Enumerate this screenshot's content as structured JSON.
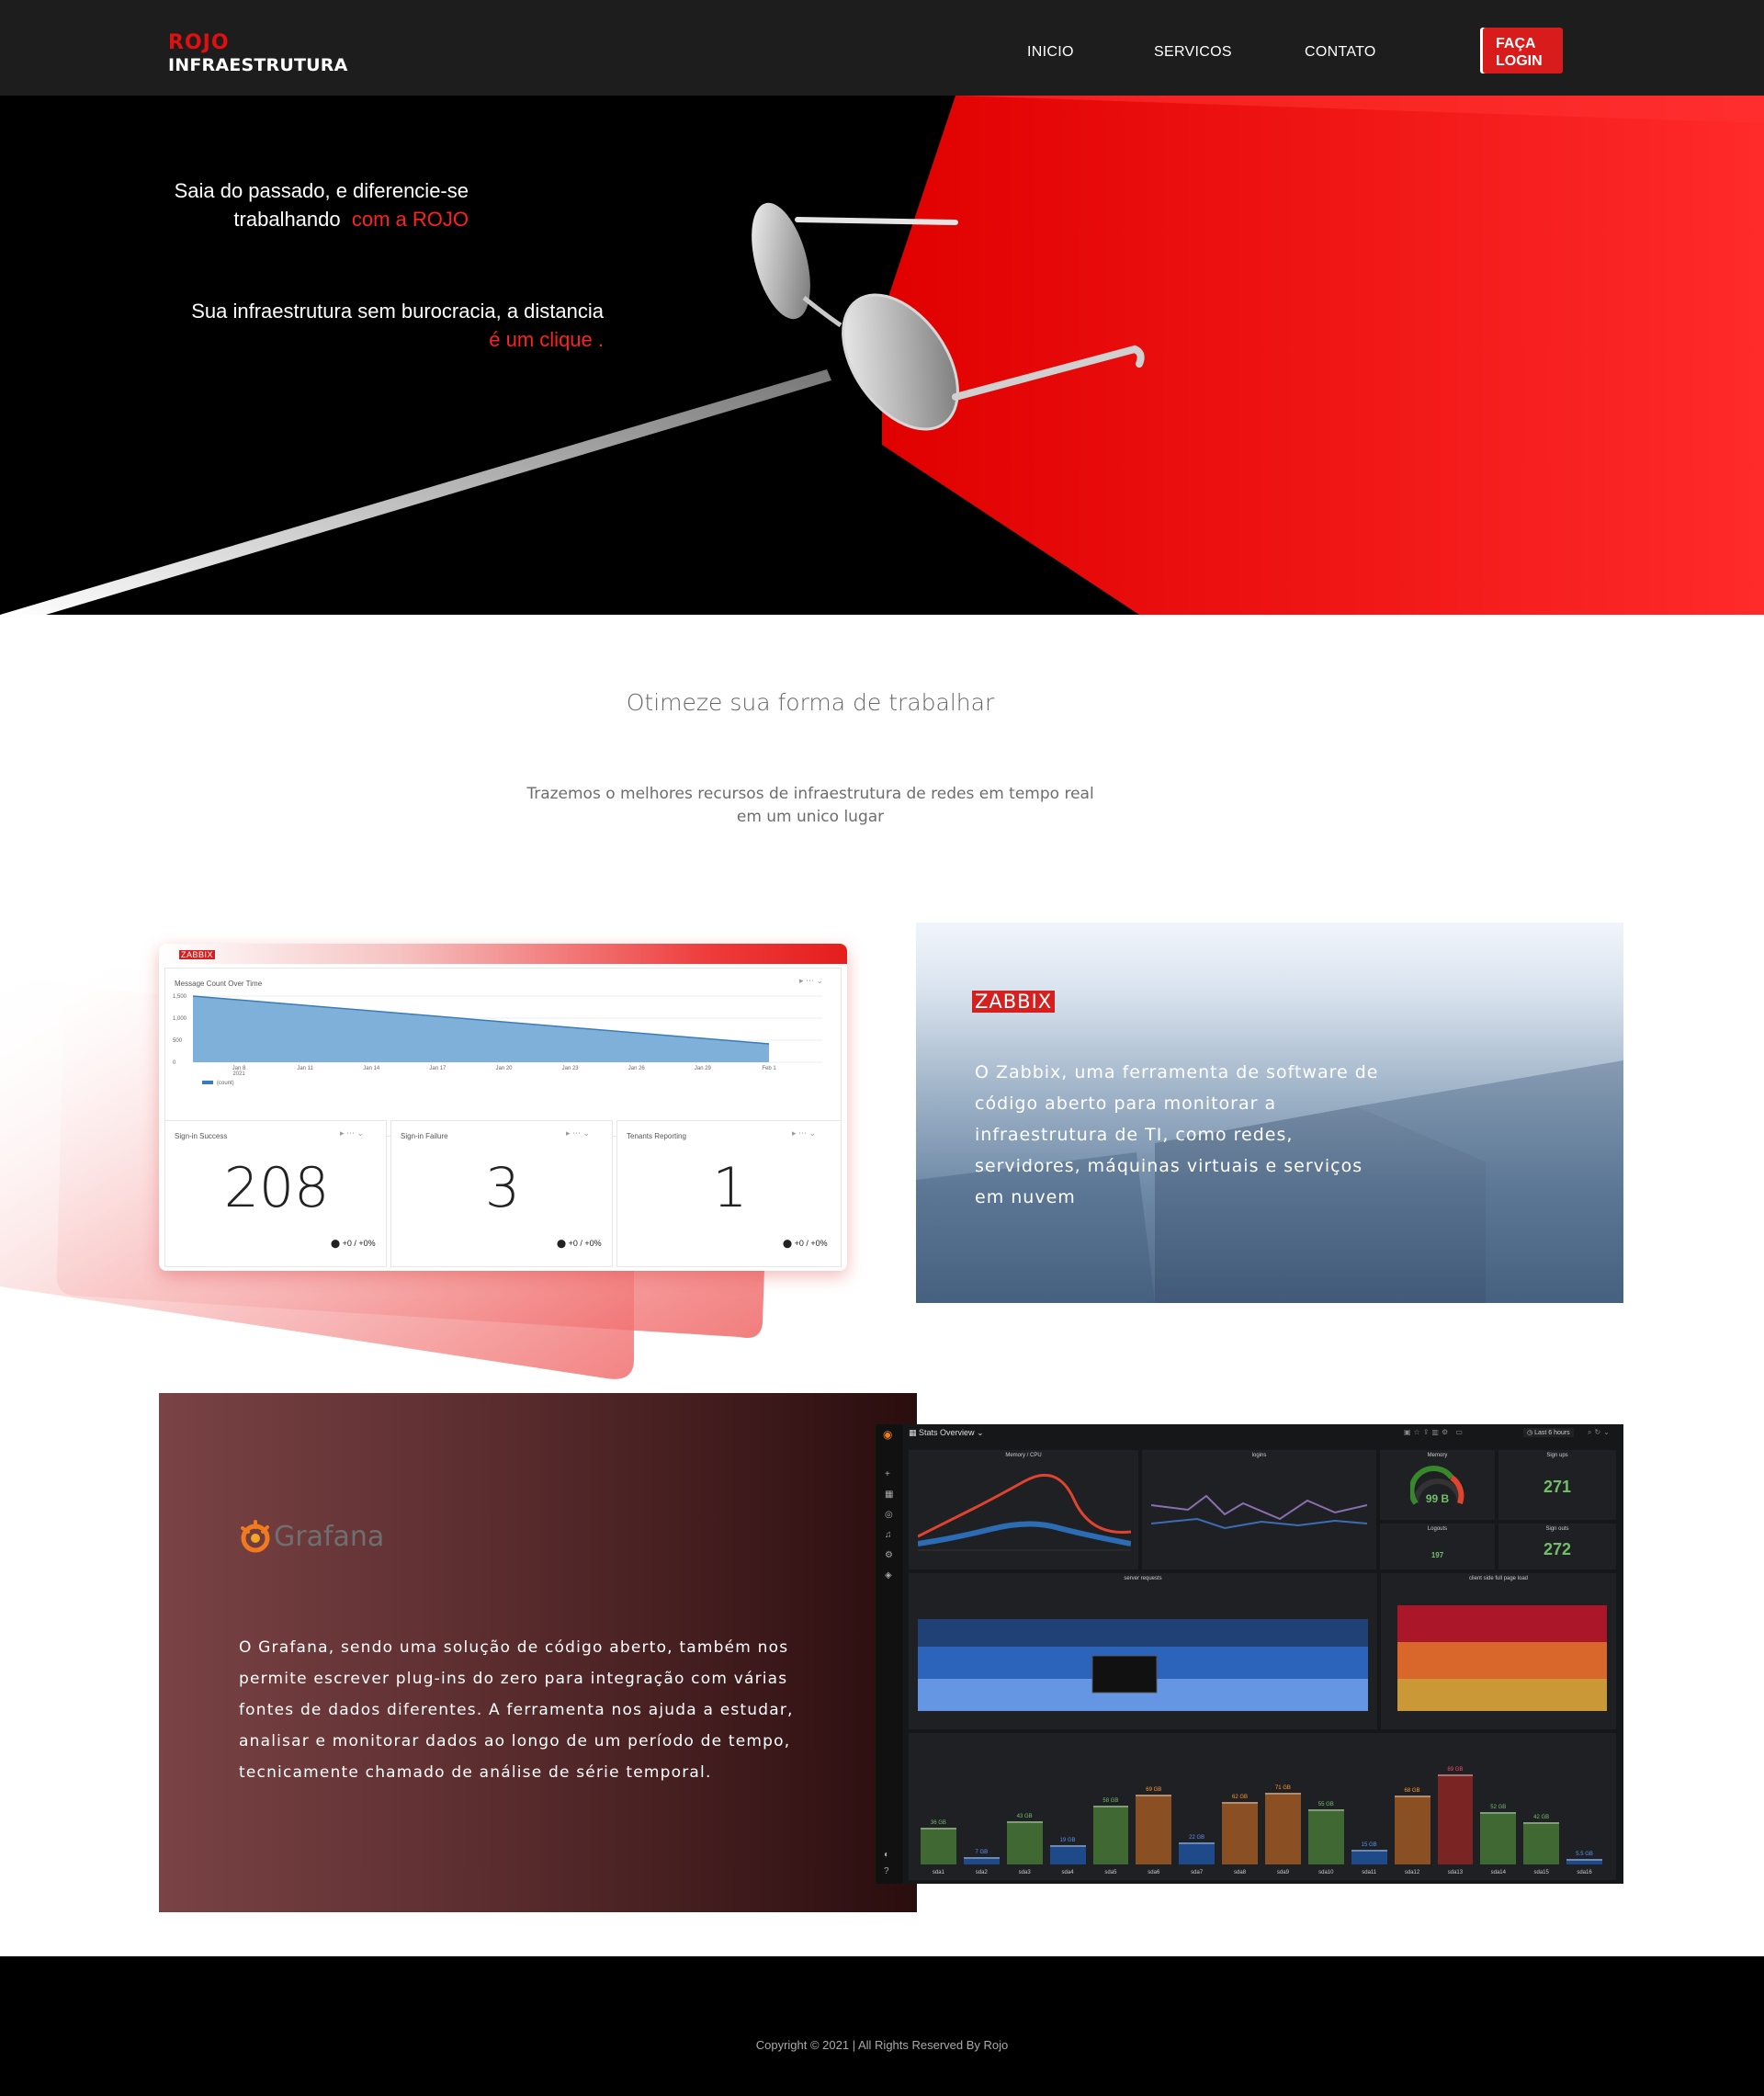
{
  "header": {
    "brand_top": "ROJO",
    "brand_bottom": "INFRAESTRUTURA",
    "nav": [
      "INICIO",
      "SERVICOS",
      "CONTATO"
    ],
    "login_label": "FAÇA\nLOGIN"
  },
  "hero": {
    "line1": "Saia do passado, e diferencie-se",
    "line2_white": "trabalhando",
    "line2_red": "com a ROJO",
    "line3": "Sua infraestrutura sem burocracia, a distancia",
    "line4_red": "é um clique ."
  },
  "intro": {
    "title": "Otimeze sua forma de trabalhar",
    "subtitle_line1": "Trazemos o melhores recursos de infraestrutura de redes em tempo real",
    "subtitle_line2": "em um unico lugar"
  },
  "zabbix": {
    "card_brand": "ZABBIX",
    "chart_title": "Message Count Over Time",
    "chart_yticks": [
      "1,500",
      "1,000",
      "500",
      "0"
    ],
    "chart_xticks": [
      "Jan 8",
      "Jan 11",
      "Jan 14",
      "Jan 17",
      "Jan 20",
      "Jan 23",
      "Jan 26",
      "Jan 29",
      "Feb 1"
    ],
    "chart_year": "2021",
    "chart_legend": "(count)",
    "stats": [
      {
        "title": "Sign-in Success",
        "value": "208",
        "delta": "+0 / +0%"
      },
      {
        "title": "Sign-in Failure",
        "value": "3",
        "delta": "+0 / +0%"
      },
      {
        "title": "Tenants Reporting",
        "value": "1",
        "delta": "+0 / +0%"
      }
    ],
    "label": "ZABBIX",
    "description": "O Zabbix, uma ferramenta de software de código aberto para monitorar a infraestrutura de TI, como redes, servidores, máquinas virtuais e serviços em nuvem"
  },
  "grafana": {
    "logo_text": "Grafana",
    "description": "O Grafana, sendo uma solução de código aberto, também nos permite escrever plug-ins do zero para integração com várias fontes de dados diferentes. A ferramenta nos ajuda a estudar, analisar e monitorar dados ao longo de um período de tempo, tecnicamente chamado de análise de série temporal.",
    "dashboard_title": "Stats Overview",
    "time_range": "Last 6 hours",
    "panels": {
      "memory_cpu": "Memory / CPU",
      "logins": "logins",
      "memory": "Memory",
      "memory_value": "99 B",
      "signups": "Sign ups",
      "signups_value": "271",
      "logouts": "Logouts",
      "logouts_value": "197",
      "signouts": "Sign outs",
      "signouts_value": "272",
      "server_requests": "server requests",
      "page_load": "client side full page load"
    },
    "disk_bars": [
      {
        "label": "sda1",
        "value": "36 GB",
        "pct": 0.36,
        "color": "#3f6833"
      },
      {
        "label": "sda2",
        "value": "7 GB",
        "pct": 0.07,
        "color": "#1f4a8a"
      },
      {
        "label": "sda3",
        "value": "43 GB",
        "pct": 0.43,
        "color": "#3f6833"
      },
      {
        "label": "sda4",
        "value": "19 GB",
        "pct": 0.19,
        "color": "#1f4a8a"
      },
      {
        "label": "sda5",
        "value": "58 GB",
        "pct": 0.58,
        "color": "#3f6833"
      },
      {
        "label": "sda6",
        "value": "69 GB",
        "pct": 0.69,
        "color": "#8a4f22"
      },
      {
        "label": "sda7",
        "value": "22 GB",
        "pct": 0.22,
        "color": "#1f4a8a"
      },
      {
        "label": "sda8",
        "value": "62 GB",
        "pct": 0.62,
        "color": "#8a4f22"
      },
      {
        "label": "sda9",
        "value": "71 GB",
        "pct": 0.71,
        "color": "#8a4f22"
      },
      {
        "label": "sda10",
        "value": "55 GB",
        "pct": 0.55,
        "color": "#3f6833"
      },
      {
        "label": "sda11",
        "value": "15 GB",
        "pct": 0.15,
        "color": "#1f4a8a"
      },
      {
        "label": "sda12",
        "value": "68 GB",
        "pct": 0.68,
        "color": "#8a4f22"
      },
      {
        "label": "sda13",
        "value": "89 GB",
        "pct": 0.89,
        "color": "#7a2424"
      },
      {
        "label": "sda14",
        "value": "52 GB",
        "pct": 0.52,
        "color": "#3f6833"
      },
      {
        "label": "sda15",
        "value": "42 GB",
        "pct": 0.42,
        "color": "#3f6833"
      },
      {
        "label": "sda16",
        "value": "5.5 GB",
        "pct": 0.055,
        "color": "#1f4a8a"
      }
    ]
  },
  "footer": {
    "copyright": "Copyright © 2021 | All Rights Reserved By Rojo"
  },
  "colors": {
    "accent": "#e01010",
    "header_bg": "#1d1d1d",
    "footer_bg": "#000000"
  }
}
